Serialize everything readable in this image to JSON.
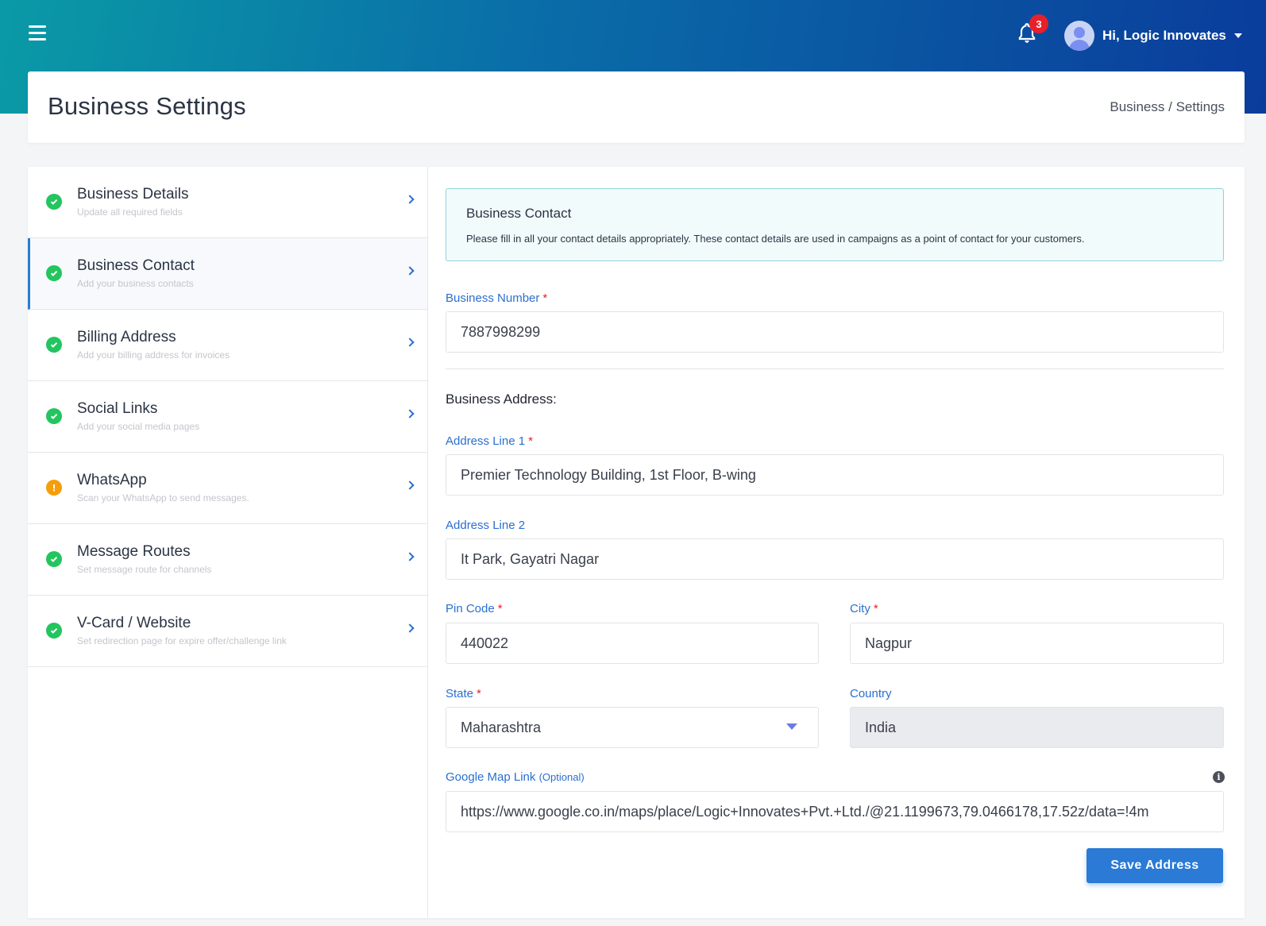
{
  "topbar": {
    "notification_count": "3",
    "user_greeting": "Hi, Logic Innovates",
    "gradient_colors": [
      "#0a9aa6",
      "#0a3c9c"
    ]
  },
  "header": {
    "title": "Business Settings",
    "breadcrumb": [
      "Business",
      "/",
      "Settings"
    ]
  },
  "sidebar": {
    "items": [
      {
        "title": "Business Details",
        "subtitle": "Update all required fields",
        "status": "complete"
      },
      {
        "title": "Business Contact",
        "subtitle": "Add your business contacts",
        "status": "complete"
      },
      {
        "title": "Billing Address",
        "subtitle": "Add your billing address for invoices",
        "status": "complete"
      },
      {
        "title": "Social Links",
        "subtitle": "Add your social media pages",
        "status": "complete"
      },
      {
        "title": "WhatsApp",
        "subtitle": "Scan your WhatsApp to send messages.",
        "status": "warning"
      },
      {
        "title": "Message Routes",
        "subtitle": "Set message route for channels",
        "status": "complete"
      },
      {
        "title": "V-Card / Website",
        "subtitle": "Set redirection page for expire offer/challenge link",
        "status": "complete"
      }
    ],
    "active_index": 1
  },
  "main": {
    "info": {
      "title": "Business Contact",
      "text": "Please fill in all your contact details appropriately. These contact details are used in campaigns as a point of contact for your customers."
    },
    "business_number": {
      "label": "Business Number",
      "required": "*",
      "value": "7887998299"
    },
    "address_heading": "Business Address:",
    "address_line1": {
      "label": "Address Line 1",
      "required": "*",
      "value": "Premier Technology Building, 1st Floor, B-wing"
    },
    "address_line2": {
      "label": "Address Line 2",
      "value": "It Park, Gayatri Nagar"
    },
    "pin_code": {
      "label": "Pin Code",
      "required": "*",
      "value": "440022"
    },
    "city": {
      "label": "City",
      "required": "*",
      "value": "Nagpur"
    },
    "state": {
      "label": "State",
      "required": "*",
      "value": "Maharashtra"
    },
    "country": {
      "label": "Country",
      "value": "India"
    },
    "map_link": {
      "label": "Google Map Link",
      "optional": "(Optional)",
      "value": "https://www.google.co.in/maps/place/Logic+Innovates+Pvt.+Ltd./@21.1199673,79.0466178,17.52z/data=!4m"
    },
    "save_label": "Save Address"
  }
}
